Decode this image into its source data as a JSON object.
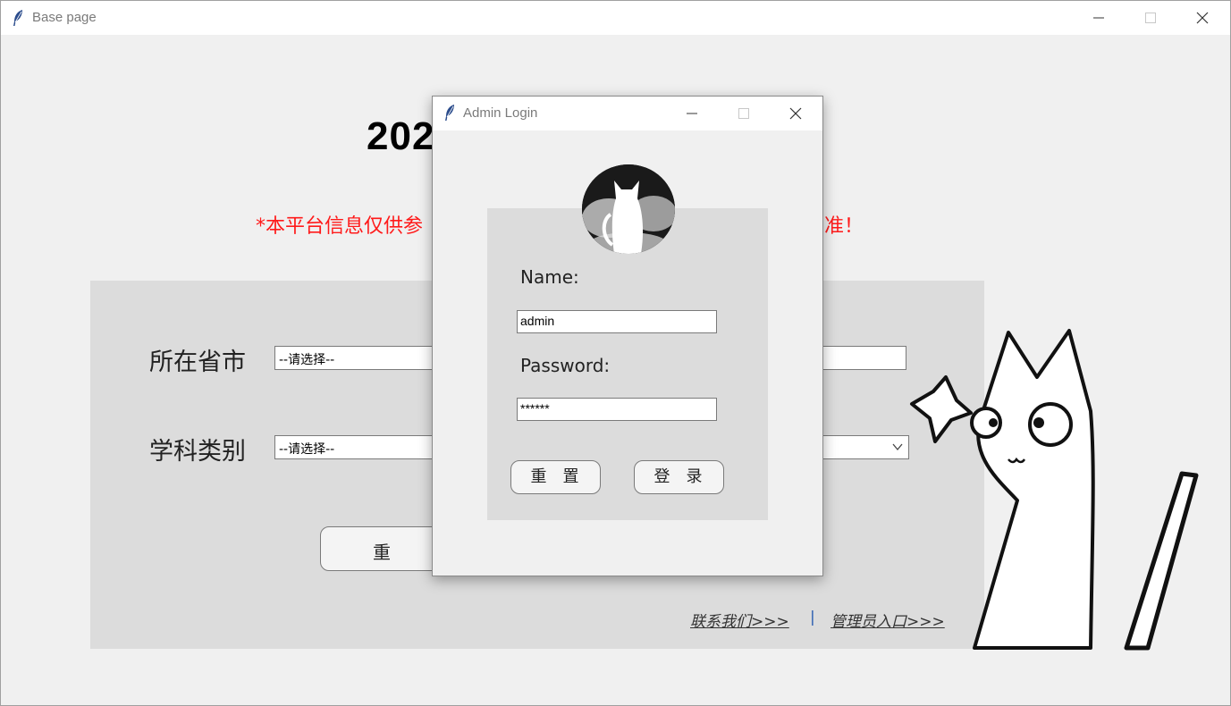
{
  "main_window": {
    "title": "Base page",
    "headline": "202",
    "notice": "*本平台信息仅供参",
    "notice_tail": "准！",
    "form": {
      "province_label": "所在省市",
      "province_select": "--请选择--",
      "subject_label": "学科类别",
      "subject_select": "--请选择--",
      "reset_button": "重   置"
    },
    "links": {
      "contact": "联系我们>>>",
      "separator": "|",
      "admin": "管理员入口>>>"
    }
  },
  "dialog": {
    "title": "Admin Login",
    "name_label": "Name:",
    "name_value": "admin",
    "password_label": "Password:",
    "password_value": "******",
    "reset_button": "重置",
    "login_button": "登录"
  },
  "colors": {
    "notice": "#ff1a1a",
    "panel": "#dcdcdc",
    "background": "#f0f0f0",
    "link_separator": "#2a5db0"
  },
  "icons": [
    "feather-icon",
    "minimize-icon",
    "maximize-icon",
    "close-icon",
    "chevron-down-icon"
  ]
}
